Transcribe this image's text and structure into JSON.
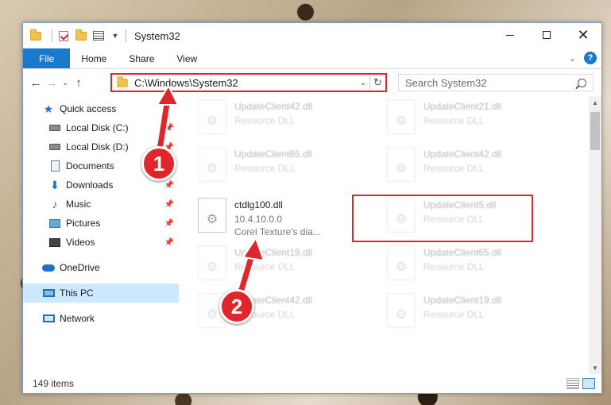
{
  "window": {
    "title": "System32",
    "quick_access_icons": [
      "folder-icon",
      "properties-check-icon",
      "new-folder-icon",
      "customize-icon"
    ]
  },
  "ribbon": {
    "tabs": [
      "File",
      "Home",
      "Share",
      "View"
    ]
  },
  "address": {
    "path": "C:\\Windows\\System32",
    "search_placeholder": "Search System32"
  },
  "sidebar": {
    "items": [
      {
        "label": "Quick access",
        "icon": "star-icon"
      },
      {
        "label": "Local Disk (C:)",
        "icon": "drive-icon",
        "pinned": true
      },
      {
        "label": "Local Disk (D:)",
        "icon": "drive-icon",
        "pinned": true
      },
      {
        "label": "Documents",
        "icon": "documents-icon",
        "pinned": true
      },
      {
        "label": "Downloads",
        "icon": "downloads-icon",
        "pinned": true
      },
      {
        "label": "Music",
        "icon": "music-icon",
        "pinned": true
      },
      {
        "label": "Pictures",
        "icon": "pictures-icon",
        "pinned": true
      },
      {
        "label": "Videos",
        "icon": "videos-icon",
        "pinned": true
      },
      {
        "label": "OneDrive",
        "icon": "onedrive-icon"
      },
      {
        "label": "This PC",
        "icon": "this-pc-icon",
        "selected": true
      },
      {
        "label": "Network",
        "icon": "network-icon"
      }
    ]
  },
  "files": {
    "left": [
      {
        "name": "UpdateClient42.dll",
        "sub": "Resource DLL",
        "faded": true
      },
      {
        "name": "UpdateClient65.dll",
        "sub": "Resource DLL",
        "faded": true
      },
      {
        "name": "ctdlg100.dll",
        "sub": "10.4.10.0.0",
        "sub2": "Corel Texture's dia...",
        "faded": false
      },
      {
        "name": "UpdateClient19.dll",
        "sub": "Resource DLL",
        "faded": true
      },
      {
        "name": "UpdateClient42.dll",
        "sub": "Resource DLL",
        "faded": true
      }
    ],
    "right": [
      {
        "name": "UpdateClient21.dll",
        "sub": "Resource DLL",
        "faded": true
      },
      {
        "name": "UpdateClient42.dll",
        "sub": "Resource DLL",
        "faded": true
      },
      {
        "name": "UpdateClient5.dll",
        "sub": "Resource DLL",
        "faded": true
      },
      {
        "name": "UpdateClient65.dll",
        "sub": "Resource DLL",
        "faded": true
      },
      {
        "name": "UpdateClient19.dll",
        "sub": "Resource DLL",
        "faded": true
      }
    ]
  },
  "status": {
    "count": "149 items"
  },
  "callouts": {
    "one": "1",
    "two": "2"
  },
  "colors": {
    "accent": "#1979ca",
    "highlight": "#e0262d",
    "selection": "#cce8ff"
  }
}
